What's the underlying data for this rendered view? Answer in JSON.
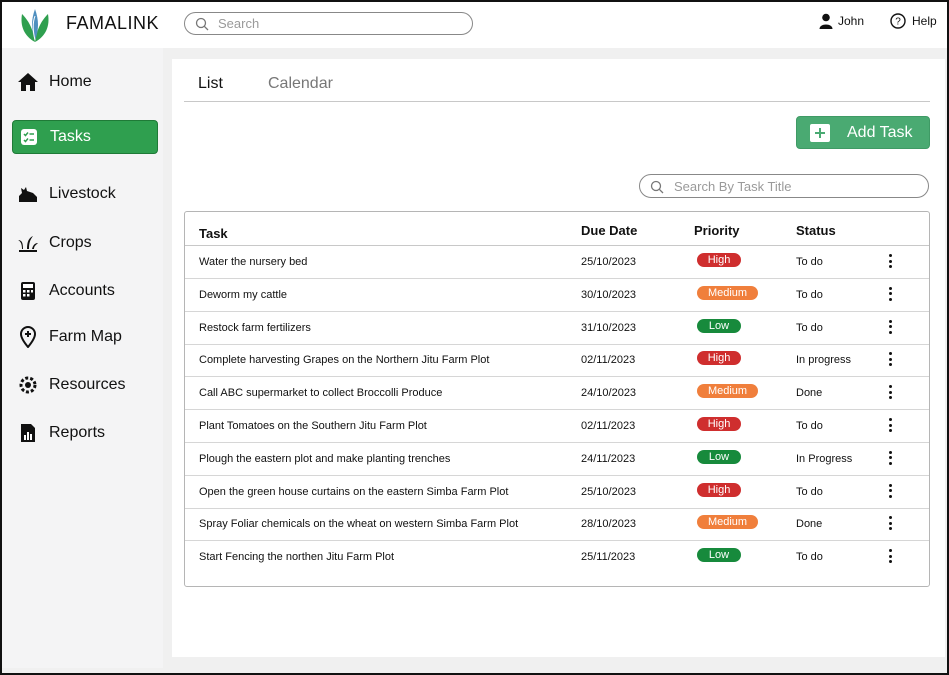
{
  "app": {
    "brand": "FAMALINK"
  },
  "header": {
    "search_placeholder": "Search",
    "user_name": "John",
    "help_label": "Help"
  },
  "sidebar": {
    "items": [
      {
        "label": "Home",
        "icon": "home-icon",
        "active": false
      },
      {
        "label": "Tasks",
        "icon": "tasks-icon",
        "active": true
      },
      {
        "label": "Livestock",
        "icon": "livestock-icon",
        "active": false
      },
      {
        "label": "Crops",
        "icon": "crops-icon",
        "active": false
      },
      {
        "label": "Accounts",
        "icon": "accounts-icon",
        "active": false
      },
      {
        "label": "Farm Map",
        "icon": "map-pin-icon",
        "active": false
      },
      {
        "label": "Resources",
        "icon": "resources-icon",
        "active": false
      },
      {
        "label": "Reports",
        "icon": "reports-icon",
        "active": false
      }
    ]
  },
  "tabs": {
    "list": "List",
    "calendar": "Calendar",
    "active": "List"
  },
  "toolbar": {
    "add_task_label": "Add Task",
    "task_search_placeholder": "Search By Task Title"
  },
  "colors": {
    "brand_green": "#2f9f4f",
    "add_button": "#4aaa72",
    "high": "#cf2e2e",
    "medium": "#f07f3c",
    "low": "#178a3c"
  },
  "table": {
    "columns": {
      "task": "Task",
      "due_date": "Due Date",
      "priority": "Priority",
      "status": "Status"
    },
    "rows": [
      {
        "task": "Water the nursery bed",
        "due": "25/10/2023",
        "priority": "High",
        "status": "To do"
      },
      {
        "task": "Deworm my cattle",
        "due": "30/10/2023",
        "priority": "Medium",
        "status": "To do"
      },
      {
        "task": "Restock farm fertilizers",
        "due": "31/10/2023",
        "priority": "Low",
        "status": "To do"
      },
      {
        "task": "Complete harvesting Grapes on the Northern Jitu Farm Plot",
        "due": "02/11/2023",
        "priority": "High",
        "status": "In progress"
      },
      {
        "task": "Call ABC supermarket to collect Broccolli Produce",
        "due": "24/10/2023",
        "priority": "Medium",
        "status": "Done"
      },
      {
        "task": "Plant Tomatoes on the Southern Jitu Farm Plot",
        "due": "02/11/2023",
        "priority": "High",
        "status": "To do"
      },
      {
        "task": "Plough the eastern plot and make planting trenches",
        "due": "24/11/2023",
        "priority": "Low",
        "status": "In Progress"
      },
      {
        "task": "Open the green house curtains on the eastern Simba Farm Plot",
        "due": "25/10/2023",
        "priority": "High",
        "status": "To do"
      },
      {
        "task": "Spray Foliar chemicals on the wheat on western Simba Farm Plot",
        "due": "28/10/2023",
        "priority": "Medium",
        "status": "Done"
      },
      {
        "task": "Start Fencing the northen Jitu Farm Plot",
        "due": "25/11/2023",
        "priority": "Low",
        "status": "To do"
      }
    ]
  }
}
